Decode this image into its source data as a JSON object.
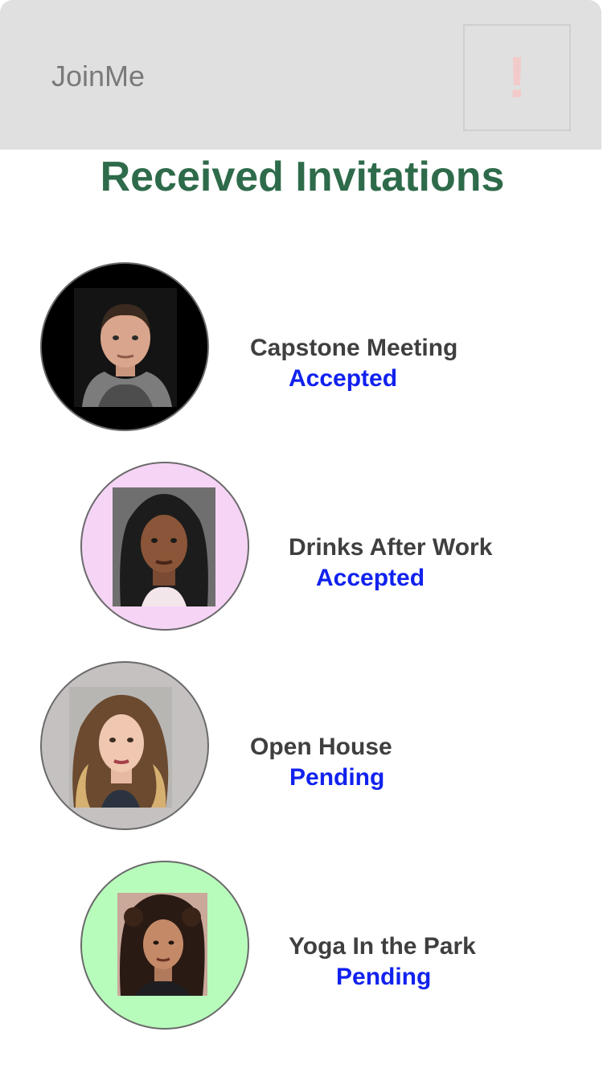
{
  "header": {
    "app_title": "JoinMe",
    "alert_glyph": "!",
    "alert_icon": "exclamation-icon"
  },
  "page": {
    "title": "Received Invitations"
  },
  "invitations": [
    {
      "event": "Capstone Meeting",
      "status": "Accepted",
      "avatar_bg": "#000000"
    },
    {
      "event": "Drinks After Work",
      "status": "Accepted",
      "avatar_bg": "#f6d4f6"
    },
    {
      "event": "Open House",
      "status": "Pending",
      "avatar_bg": "#c4c1c0"
    },
    {
      "event": "Yoga In the Park",
      "status": "Pending",
      "avatar_bg": "#b8fcbc"
    }
  ],
  "colors": {
    "header_bg": "#e0e0e0",
    "title_green": "#2e6b4a",
    "status_blue": "#1122ee",
    "event_text": "#3f3f3f"
  }
}
